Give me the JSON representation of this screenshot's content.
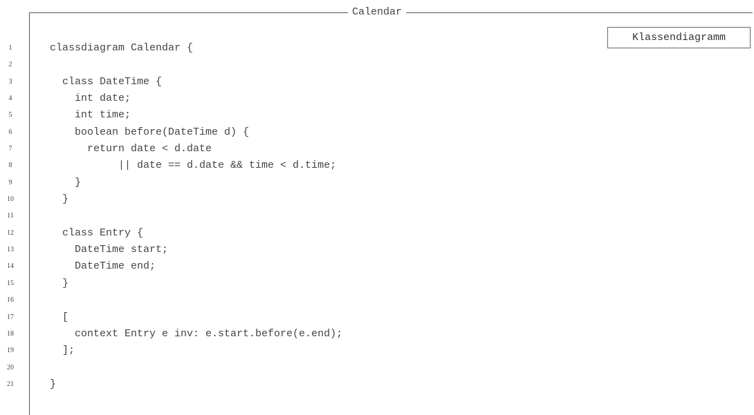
{
  "frame": {
    "title": "Calendar",
    "stereotype": "Klassendiagramm"
  },
  "code_lines": [
    {
      "number": "1",
      "text": "classdiagram Calendar {"
    },
    {
      "number": "2",
      "text": ""
    },
    {
      "number": "3",
      "text": "  class DateTime {"
    },
    {
      "number": "4",
      "text": "    int date;"
    },
    {
      "number": "5",
      "text": "    int time;"
    },
    {
      "number": "6",
      "text": "    boolean before(DateTime d) {"
    },
    {
      "number": "7",
      "text": "      return date < d.date"
    },
    {
      "number": "8",
      "text": "           || date == d.date && time < d.time;"
    },
    {
      "number": "9",
      "text": "    }"
    },
    {
      "number": "10",
      "text": "  }"
    },
    {
      "number": "11",
      "text": ""
    },
    {
      "number": "12",
      "text": "  class Entry {"
    },
    {
      "number": "13",
      "text": "    DateTime start;"
    },
    {
      "number": "14",
      "text": "    DateTime end;"
    },
    {
      "number": "15",
      "text": "  }"
    },
    {
      "number": "16",
      "text": ""
    },
    {
      "number": "17",
      "text": "  ["
    },
    {
      "number": "18",
      "text": "    context Entry e inv: e.start.before(e.end);"
    },
    {
      "number": "19",
      "text": "  ];"
    },
    {
      "number": "20",
      "text": ""
    },
    {
      "number": "21",
      "text": "}"
    }
  ]
}
